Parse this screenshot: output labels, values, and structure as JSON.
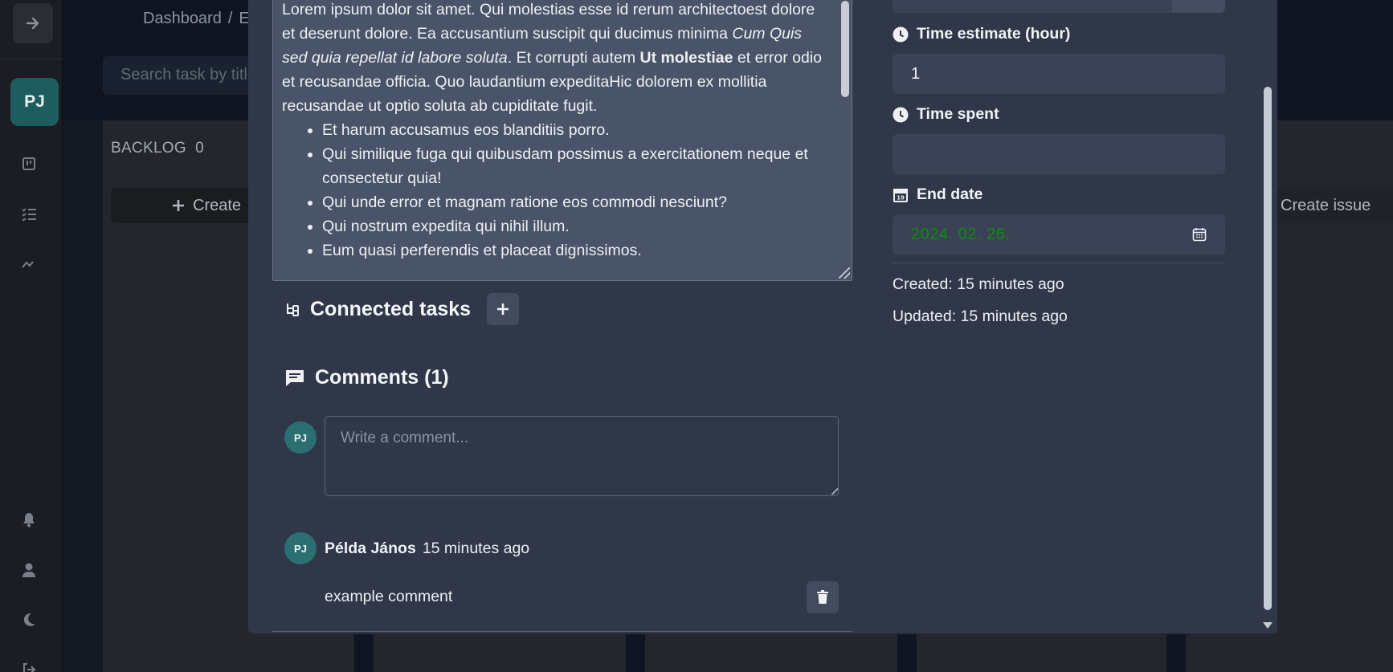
{
  "breadcrumb": {
    "root": "Dashboard",
    "separator": "/",
    "current": "E"
  },
  "search": {
    "placeholder": "Search task by title"
  },
  "user": {
    "initials": "PJ"
  },
  "board": {
    "columns": [
      {
        "title": "BACKLOG",
        "count": "0"
      }
    ],
    "create_label": "Create",
    "create_issue_label": "Create issue"
  },
  "description": {
    "para_1": "Lorem ipsum dolor sit amet. Qui molestias esse id rerum architectoest dolore et deserunt dolore. Ea accusantium suscipit qui ducimus minima ",
    "para_1_italic": "Cum Quis sed quia repellat id labore soluta",
    "para_1_b": ". Et corrupti autem ",
    "para_1_bold": "Ut molestiae",
    "para_1_c": " et error odio et recusandae officia. Quo laudantium expeditaHic dolorem ex mollitia recusandae ut optio soluta ab cupiditate fugit.",
    "bullets": [
      "Et harum accusamus eos blanditiis porro.",
      "Qui similique fuga qui quibusdam possimus a exercitationem neque et consectetur quia!",
      "Qui unde error et magnam ratione eos commodi nesciunt?",
      "Qui nostrum expedita qui nihil illum.",
      "Eum quasi perferendis et placeat dignissimos."
    ]
  },
  "connected_tasks": {
    "title": "Connected tasks"
  },
  "comments": {
    "title": "Comments (1)",
    "input_placeholder": "Write a comment...",
    "items": [
      {
        "initials": "PJ",
        "author": "Példa János",
        "time": "15 minutes ago",
        "text": "example comment"
      }
    ]
  },
  "details": {
    "time_estimate_label": "Time estimate (hour)",
    "time_estimate_value": "1",
    "time_spent_label": "Time spent",
    "time_spent_value": "",
    "end_date_label": "End date",
    "end_date_value": "2024. 02. 26.",
    "end_date_icon_day": "19",
    "created": "Created: 15 minutes ago",
    "updated": "Updated: 15 minutes ago"
  },
  "colors": {
    "accent_avatar": "#1d5c5f",
    "date_text": "#0f8a0f",
    "modal_bg": "#2f3749"
  }
}
